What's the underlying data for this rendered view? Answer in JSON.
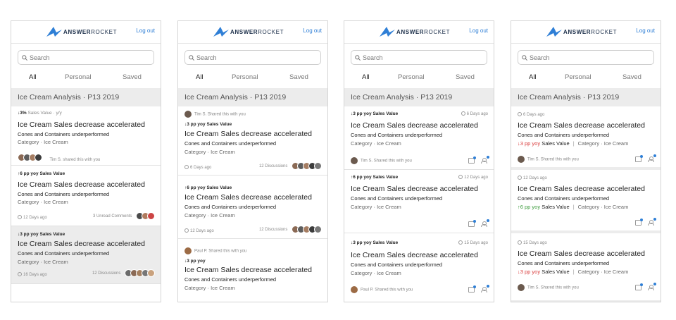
{
  "brand": {
    "name_bold": "ANSWER",
    "name_light": "ROCKET"
  },
  "header": {
    "logout": "Log out"
  },
  "search": {
    "placeholder": "Search"
  },
  "tabs": [
    "All",
    "Personal",
    "Saved"
  ],
  "section_title": "Ice Cream Analysis · P13 2019",
  "common": {
    "headline_accel": "Ice Cream Sales decrease accelerated",
    "sub": "Cones and Containers underperformed",
    "category": "Category · Ice Cream",
    "sales_value": "Sales Value",
    "category_inline": "Category · Ice Cream"
  },
  "s1": {
    "c1": {
      "delta": "↓3%",
      "metric": "Sales Value · y/y",
      "shared": "Tim S. shared this with you"
    },
    "c2": {
      "delta": "↑6 pp yoy",
      "time": "12 Days ago",
      "comments": "3 Unread Comments"
    },
    "c3": {
      "delta": "↓3 pp yoy",
      "time": "16 Days ago",
      "discussions": "12 Discussions"
    }
  },
  "s2": {
    "c1": {
      "shared": "Tim S. Shared this with you",
      "delta": "↓3 pp yoy",
      "time": "6 Days ago",
      "discussions": "12 Discussions"
    },
    "c2": {
      "delta": "↑6 pp yoy",
      "time": "12 Days ago",
      "discussions": "12 Discussions"
    },
    "c3": {
      "shared": "Paul P. Shared this with you",
      "delta": "↓3 pp yoy"
    }
  },
  "s3": {
    "c1": {
      "delta": "↓3 pp yoy",
      "time": "6 Days ago",
      "shared": "Tim S. Shared this with you"
    },
    "c2": {
      "delta": "↑6 pp yoy",
      "time": "12 Days ago"
    },
    "c3": {
      "delta": "↓3 pp yoy",
      "time": "15 Days ago",
      "shared": "Paul P. Shared this with you"
    }
  },
  "s4": {
    "c1": {
      "time": "6 Days ago",
      "delta": "↓3 pp yoy",
      "shared": "Tim S. Shared this with you"
    },
    "c2": {
      "time": "12 Days ago",
      "delta": "↑6 pp yoy"
    },
    "c3": {
      "time": "15 Days ago",
      "delta": "↓3 pp yoy",
      "shared": "Tim S. Shared this with you"
    }
  },
  "colors": {
    "accent": "#2f7fd6",
    "down": "#d93a3a",
    "up": "#3a9a3a"
  }
}
